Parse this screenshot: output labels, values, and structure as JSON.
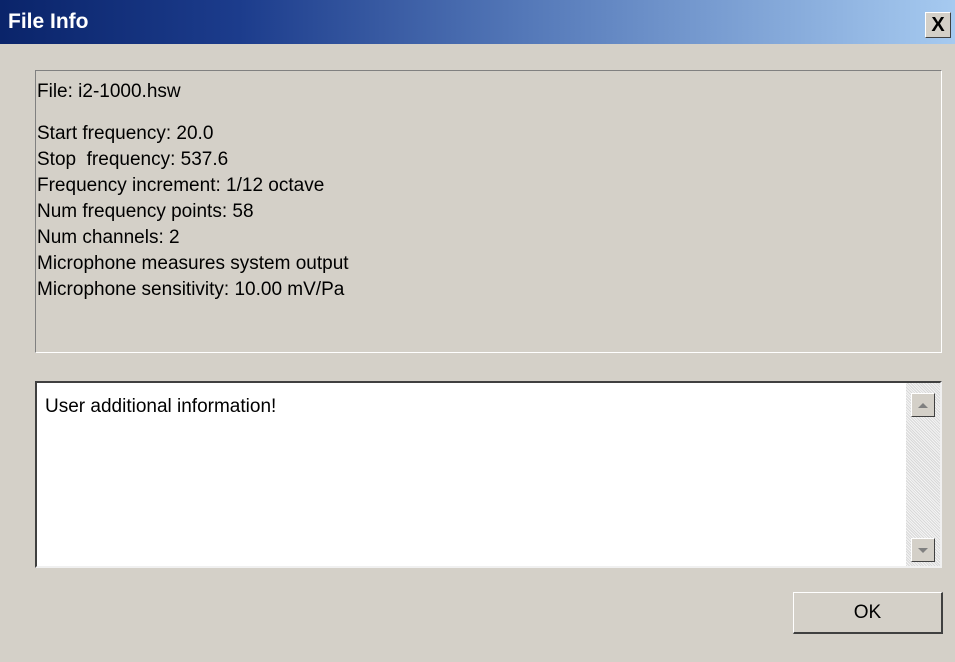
{
  "window": {
    "title": "File Info",
    "close_label": "X"
  },
  "info": {
    "file": "File: i2-1000.hsw",
    "lines": [
      "Start frequency: 20.0",
      "Stop  frequency: 537.6",
      "Frequency increment: 1/12 octave",
      "Num frequency points: 58",
      "Num channels: 2",
      "Microphone measures system output",
      "Microphone sensitivity: 10.00 mV/Pa"
    ]
  },
  "user_info": {
    "text": "User additional information!"
  },
  "buttons": {
    "ok_label": "OK"
  },
  "colors": {
    "dialog_bg": "#d4d0c8",
    "title_gradient_start": "#0a246a",
    "title_gradient_end": "#a6caf0",
    "title_text": "#ffffff"
  },
  "icons": {
    "scroll_up": "scroll-up-arrow-icon",
    "scroll_down": "scroll-down-arrow-icon"
  }
}
